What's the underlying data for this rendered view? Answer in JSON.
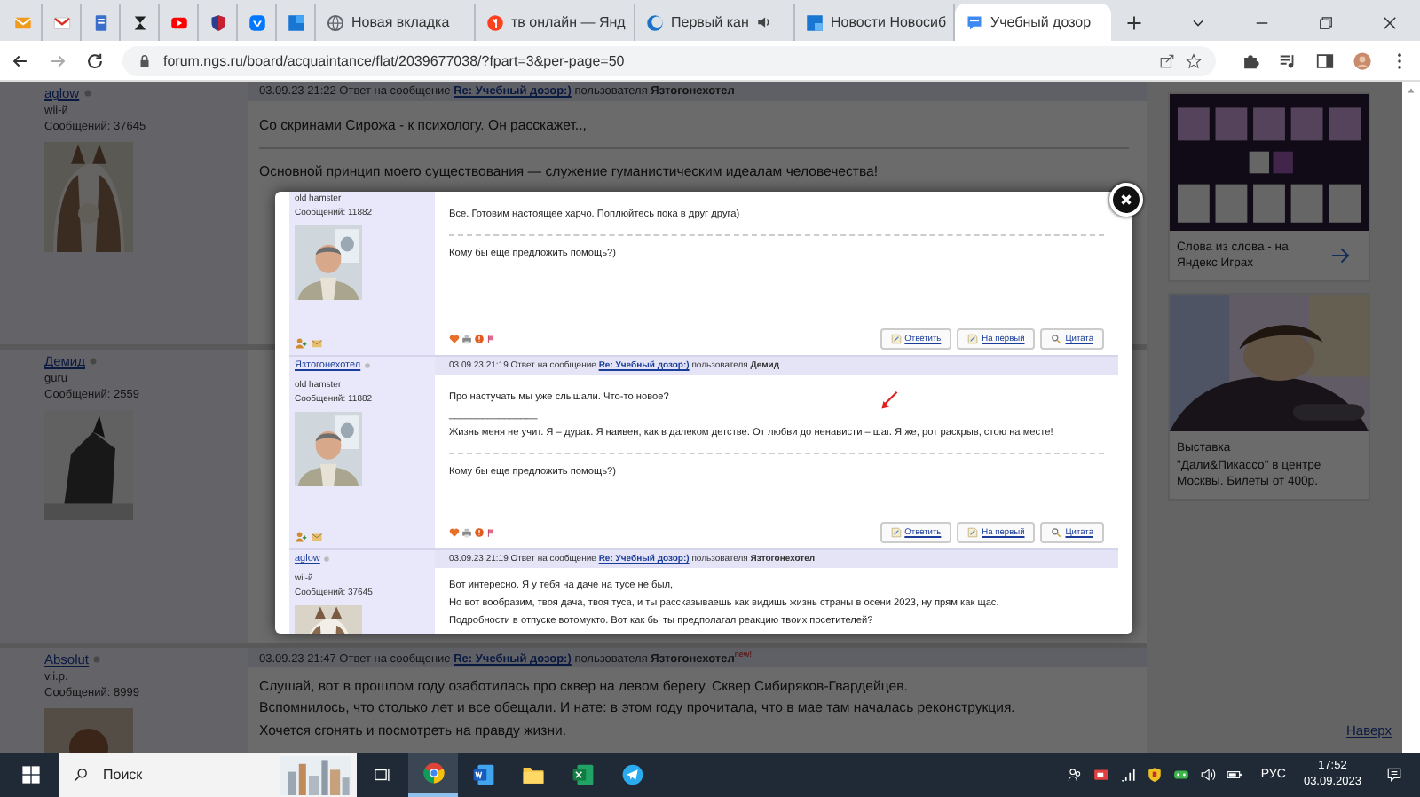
{
  "tabs": [
    {
      "kind": "icon",
      "selected": false
    },
    {
      "kind": "icon",
      "selected": false
    },
    {
      "kind": "icon",
      "selected": false
    },
    {
      "kind": "icon",
      "selected": false
    },
    {
      "kind": "icon",
      "selected": false
    },
    {
      "kind": "icon",
      "selected": false
    },
    {
      "kind": "icon",
      "selected": false
    },
    {
      "kind": "icon",
      "selected": false
    },
    {
      "kind": "text",
      "label": "Новая вкладка",
      "selected": false,
      "audio": false
    },
    {
      "kind": "text",
      "label": "тв онлайн — Янд",
      "selected": false,
      "audio": false
    },
    {
      "kind": "text",
      "label": "Первый кан",
      "selected": false,
      "audio": true
    },
    {
      "kind": "text",
      "label": "Новости Новосиб",
      "selected": false,
      "audio": false
    },
    {
      "kind": "text",
      "label": "Учебный дозор",
      "selected": true,
      "audio": false
    }
  ],
  "address": "forum.ngs.ru/board/acquaintance/flat/2039677038/?fpart=3&per-page=50",
  "forum_posts": [
    {
      "author": "aglow",
      "rank": "wii-й",
      "count": "Сообщений: 37645",
      "header": {
        "prefix": "03.09.23 21:22 Ответ на сообщение",
        "topic": "Re: Учебный дозор:)",
        "suffix": "пользователя **Язтогонехотел**"
      },
      "lines": [
        "Со скринами Сирожа - к психологу. Он расскажет..,"
      ],
      "signature": "Основной принцип моего существования — служение гуманистическим идеалам человечества!"
    },
    {
      "author": "Демид",
      "rank": "guru",
      "count": "Сообщений: 2559"
    },
    {
      "author": "Absolut",
      "rank": "v.i.p.",
      "count": "Сообщений: 8999",
      "header": {
        "prefix": "03.09.23 21:47 Ответ на сообщение",
        "topic": "Re: Учебный дозор:)",
        "suffix": "пользователя **Язтогонехотел**$^{new!}$"
      },
      "lines": [
        "Слушай, вот в прошлом году озаботилась про сквер на левом берегу. Сквер Сибиряков-Гвардейцев.",
        "Вспомнилось, что столько лет и все обещали. И нате: в этом году прочитала, что в мае там началась реконструкция.",
        "Хочется сгонять и посмотреть на правду жизни."
      ]
    }
  ],
  "modal_posts": [
    {
      "rank": "old hamster",
      "count": "Сообщений: 11882",
      "lines": [
        "Все. Готовим настоящее харчо. Поплюйтесь пока в друг друга)"
      ],
      "signature": "Кому бы еще предложить помощь?)",
      "annotation": false,
      "buttons": [
        "Ответить",
        "На первый",
        "Цитата"
      ]
    },
    {
      "author": "Язтогонехотел",
      "header": {
        "prefix": "03.09.23 21:19 Ответ на сообщение",
        "topic": "Re: Учебный дозор:)",
        "suffix": "пользователя **Демид**"
      },
      "rank": "old hamster",
      "count": "Сообщений: 11882",
      "lines": [
        "Про настучать мы уже слышали. Что-то новое?",
        "________________",
        "Жизнь меня не учит. Я – дурак. Я наивен, как в далеком детстве. От любви до ненависти – шаг. Я же, рот раскрыв, стою на месте!"
      ],
      "signature": "Кому бы еще предложить помощь?)",
      "annotation": true,
      "buttons": [
        "Ответить",
        "На первый",
        "Цитата"
      ]
    },
    {
      "author": "aglow",
      "header": {
        "prefix": "03.09.23 21:19 Ответ на сообщение",
        "topic": "Re: Учебный дозор:)",
        "suffix": "пользователя **Язтогонехотел**"
      },
      "rank": "wii-й",
      "count": "Сообщений: 37645",
      "lines": [
        "Вот интересно. Я у тебя на даче на тусе не был,",
        "Но вот вообразим, твоя дача, твоя туса, и ты рассказываешь как видишь жизнь страны в осени 2023, ну прям как щас.",
        "Подробности в отпуске вотомукто. Вот как бы ты предполагал реакцию твоих посетителей?"
      ],
      "annotation": false
    }
  ],
  "ads": [
    {
      "kind": "game",
      "text": "Слова из слова - на Яндекс Играх"
    },
    {
      "kind": "event",
      "text": "Выставка \"Дали&Пикассо\" в центре Москвы. Билеты от 400р."
    }
  ],
  "back_to_top": "Наверх",
  "taskbar": {
    "search_placeholder": "Поиск",
    "apps": [
      {
        "selected": true
      },
      {
        "selected": false
      },
      {
        "selected": false
      },
      {
        "selected": false
      },
      {
        "selected": false
      }
    ],
    "language": "РУС",
    "time": "17:52",
    "date": "03.09.2023"
  }
}
